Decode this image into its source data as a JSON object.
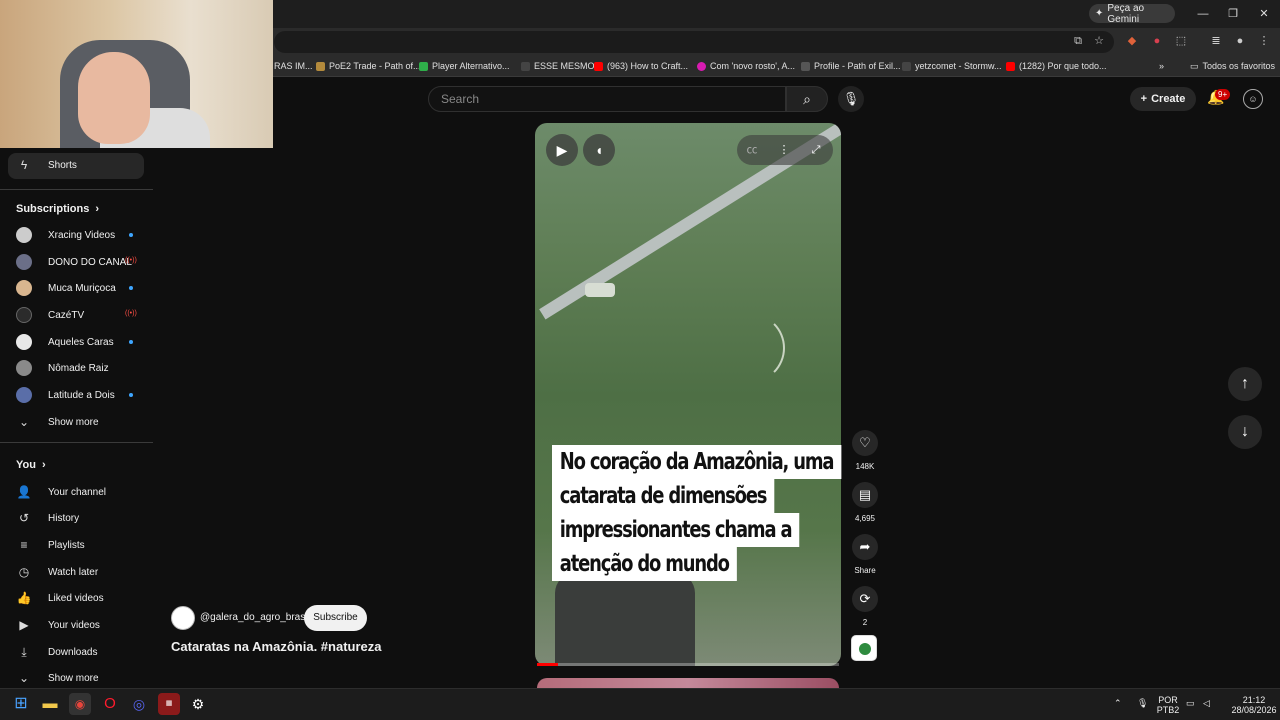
{
  "browser": {
    "gemini_label": "Peça ao Gemini",
    "bookmarks": [
      {
        "label": "RAS IM...",
        "color": "#8a8a8a"
      },
      {
        "label": "PoE2 Trade - Path of...",
        "color": "#b38a3c"
      },
      {
        "label": "Player Alternativo...",
        "color": "#2fae4a"
      },
      {
        "label": "ESSE MESMO",
        "color": "#444444"
      },
      {
        "label": "(963) How to Craft...",
        "color": "#ff0000"
      },
      {
        "label": "Com 'novo rosto', A...",
        "color": "#d81bb1"
      },
      {
        "label": "Profile - Path of Exil...",
        "color": "#555555"
      },
      {
        "label": "yetzcomet - Stormw...",
        "color": "#444444"
      },
      {
        "label": "(1282) Por que todo...",
        "color": "#ff0000"
      }
    ],
    "all_bookmarks_label": "Todos os favoritos"
  },
  "header": {
    "search_placeholder": "Search",
    "create_label": "Create",
    "notification_count": "9+"
  },
  "sidebar": {
    "shorts_label": "Shorts",
    "subscriptions_heading": "Subscriptions",
    "subscriptions": [
      {
        "name": "Xracing Videos",
        "indicator": "new",
        "avatar_color": "#cccccc"
      },
      {
        "name": "DONO DO CANAL",
        "indicator": "live",
        "avatar_color": "#6b6f88"
      },
      {
        "name": "Muca Muriçoca",
        "indicator": "new",
        "avatar_color": "#d9b68f"
      },
      {
        "name": "CazéTV",
        "indicator": "live",
        "avatar_color": "#2b2b2b"
      },
      {
        "name": "Aqueles Caras",
        "indicator": "new",
        "avatar_color": "#e8e8e8"
      },
      {
        "name": "Nômade Raiz",
        "indicator": "none",
        "avatar_color": "#8a8a8a"
      },
      {
        "name": "Latitude a Dois",
        "indicator": "new",
        "avatar_color": "#5a6ea8"
      }
    ],
    "show_more_1": "Show more",
    "you_heading": "You",
    "you_items": [
      {
        "label": "Your channel",
        "icon": "👤"
      },
      {
        "label": "History",
        "icon": "↺"
      },
      {
        "label": "Playlists",
        "icon": "≡"
      },
      {
        "label": "Watch later",
        "icon": "◷"
      },
      {
        "label": "Liked videos",
        "icon": "👍"
      },
      {
        "label": "Your videos",
        "icon": "▶"
      },
      {
        "label": "Downloads",
        "icon": "⤓"
      }
    ],
    "show_more_2": "Show more"
  },
  "short": {
    "caption_lines": [
      "No coração da Amazônia, uma",
      "catarata de dimensões",
      "impressionantes chama a",
      "atenção do mundo"
    ],
    "progress": 0.07,
    "likes": "148K",
    "comments": "4,695",
    "share_label": "Share",
    "remix_count": "2",
    "channel": "@galera_do_agro_brasil",
    "subscribe_label": "Subscribe",
    "title": "Cataratas na Amazônia. #natureza"
  },
  "taskbar": {
    "language": "POR",
    "layout": "PTB2",
    "time": "21:12",
    "date": "28/08/2026"
  }
}
